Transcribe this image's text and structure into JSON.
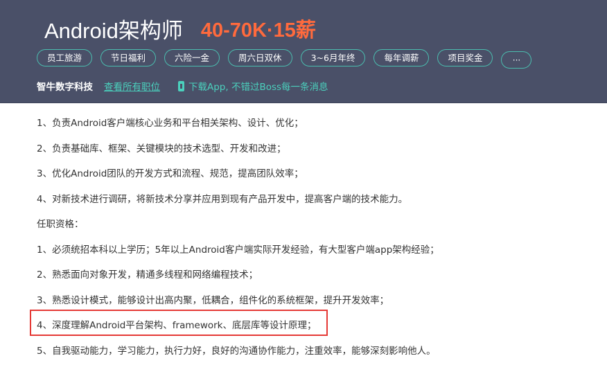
{
  "header": {
    "job_title": "Android架构师",
    "salary": "40-70K·15薪",
    "tags": [
      "员工旅游",
      "节日福利",
      "六险一金",
      "周六日双休",
      "3~6月年终",
      "每年调薪",
      "项目奖金"
    ],
    "more_label": "···",
    "company_name": "智牛数字科技",
    "all_jobs_link": "查看所有职位",
    "app_link": "下载App, 不错过Boss每一条消息"
  },
  "description": {
    "lines": [
      "1、负责Android客户端核心业务和平台相关架构、设计、优化；",
      "2、负责基础库、框架、关键模块的技术选型、开发和改进；",
      "3、优化Android团队的开发方式和流程、规范，提高团队效率；",
      "4、对新技术进行调研，将新技术分享并应用到现有产品开发中，提高客户端的技术能力。",
      "任职资格：",
      "1、必须统招本科以上学历；5年以上Android客户端实际开发经验，有大型客户端app架构经验；",
      "2、熟悉面向对象开发，精通多线程和网络编程技术；",
      "3、熟悉设计模式，能够设计出高内聚，低耦合，组件化的系统框架，提升开发效率；",
      "4、深度理解Android平台架构、framework、底层库等设计原理；",
      "5、自我驱动能力，学习能力，执行力好，良好的沟通协作能力，注重效率，能够深刻影响他人。"
    ]
  },
  "colors": {
    "header_bg": "#4a5068",
    "accent_teal": "#4bd0bd",
    "salary_orange": "#ff6a3d",
    "highlight_red": "#e53935"
  }
}
